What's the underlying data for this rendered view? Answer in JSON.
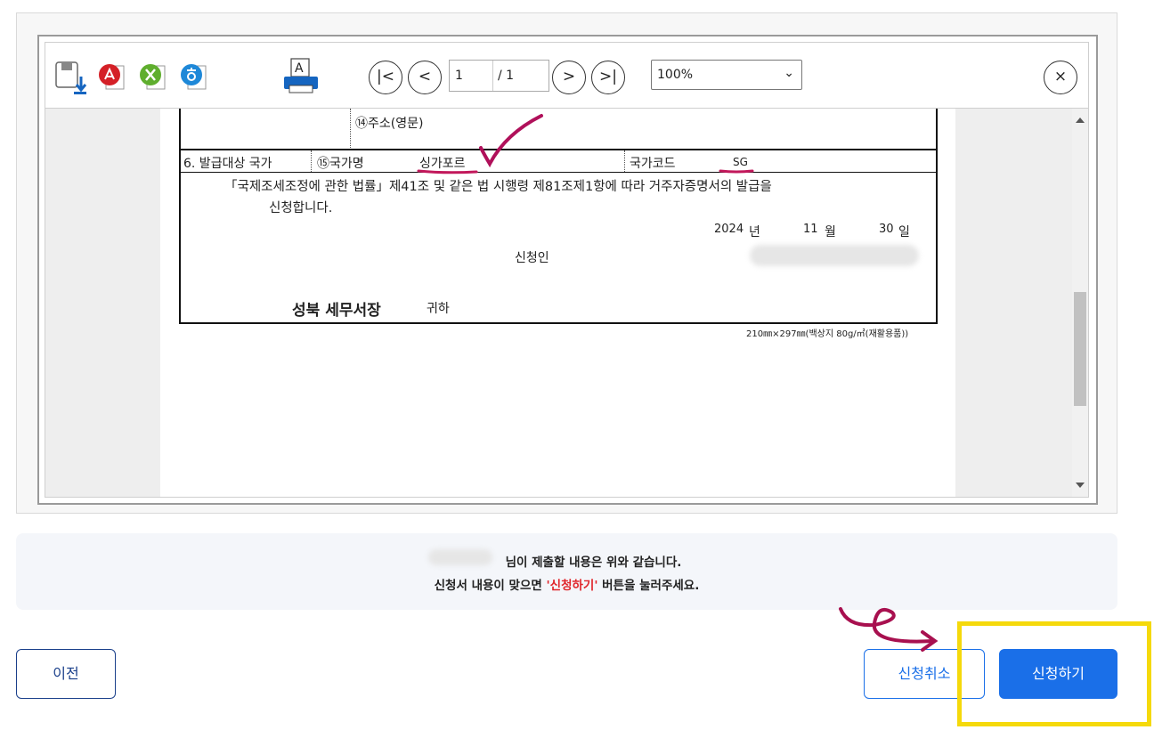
{
  "toolbar": {
    "save_icon": "save-download-icon",
    "pdf_icon": "pdf-export-icon",
    "excel_icon": "excel-export-icon",
    "hwp_icon": "hwp-export-icon",
    "print_icon": "print-icon",
    "current_page": "1",
    "total_pages": "/ 1",
    "zoom": "100%",
    "first_page_glyph": "|<",
    "prev_page_glyph": "<",
    "next_page_glyph": ">",
    "last_page_glyph": ">|",
    "close_glyph": "×"
  },
  "document": {
    "address_en_label": "⑭주소(영문)",
    "issue_country_label": "6. 발급대상 국가",
    "country_name_label": "⑮국가명",
    "country_name_value": "싱가포르",
    "country_code_label": "국가코드",
    "country_code_value": "SG",
    "statement_line1": "「국제조세조정에 관한 법률」제41조 및 같은 법 시행령 제81조제1항에 따라 거주자증명서의 발급을",
    "statement_line2": "신청합니다.",
    "year_value": "2024",
    "year_unit": "년",
    "month_value": "11",
    "month_unit": "월",
    "day_value": "30",
    "day_unit": "일",
    "applicant_label": "신청인",
    "office": "성북 세무서장",
    "addressee": "귀하",
    "paper_note": "210㎜×297㎜(백상지 80g/㎡(재활용품))"
  },
  "notice": {
    "line1": "님이 제출할 내용은 위와 같습니다.",
    "line2_prefix": "신청서 내용이 맞으면 ",
    "line2_highlight": "'신청하기'",
    "line2_suffix": " 버튼을 눌러주세요."
  },
  "buttons": {
    "prev": "이전",
    "cancel": "신청취소",
    "apply": "신청하기"
  },
  "colors": {
    "primary": "#1a6fe8",
    "highlight_red": "#e0262b",
    "annotation": "#b0105a",
    "focus_box": "#f5d90b"
  }
}
